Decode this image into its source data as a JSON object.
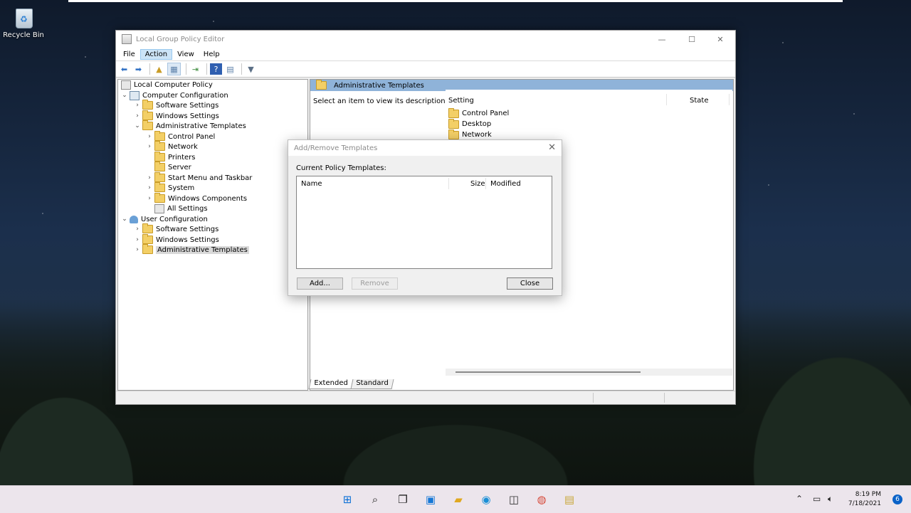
{
  "desktop": {
    "recycle_bin_label": "Recycle Bin"
  },
  "window": {
    "title": "Local Group Policy Editor",
    "menu": [
      "File",
      "Action",
      "View",
      "Help"
    ],
    "active_menu": "Action",
    "tree": {
      "root": "Local Computer Policy",
      "computer_config": "Computer Configuration",
      "cc_software": "Software Settings",
      "cc_windows": "Windows Settings",
      "cc_admin": "Administrative Templates",
      "control_panel": "Control Panel",
      "network": "Network",
      "printers": "Printers",
      "server": "Server",
      "start_menu": "Start Menu and Taskbar",
      "system": "System",
      "windows_components": "Windows Components",
      "all_settings": "All Settings",
      "user_config": "User Configuration",
      "uc_software": "Software Settings",
      "uc_windows": "Windows Settings",
      "uc_admin": "Administrative Templates"
    },
    "right_pane": {
      "header": "Administrative Templates",
      "description": "Select an item to view its description.",
      "col_setting": "Setting",
      "col_state": "State",
      "items": [
        "Control Panel",
        "Desktop",
        "Network"
      ]
    },
    "tabs": [
      "Extended",
      "Standard"
    ]
  },
  "dialog": {
    "title": "Add/Remove Templates",
    "label": "Current Policy Templates:",
    "columns": [
      "Name",
      "Size",
      "Modified"
    ],
    "add_button": "Add...",
    "remove_button": "Remove",
    "close_button": "Close"
  },
  "taskbar": {
    "time": "8:19 PM",
    "date": "7/18/2021",
    "notification_count": "6"
  }
}
